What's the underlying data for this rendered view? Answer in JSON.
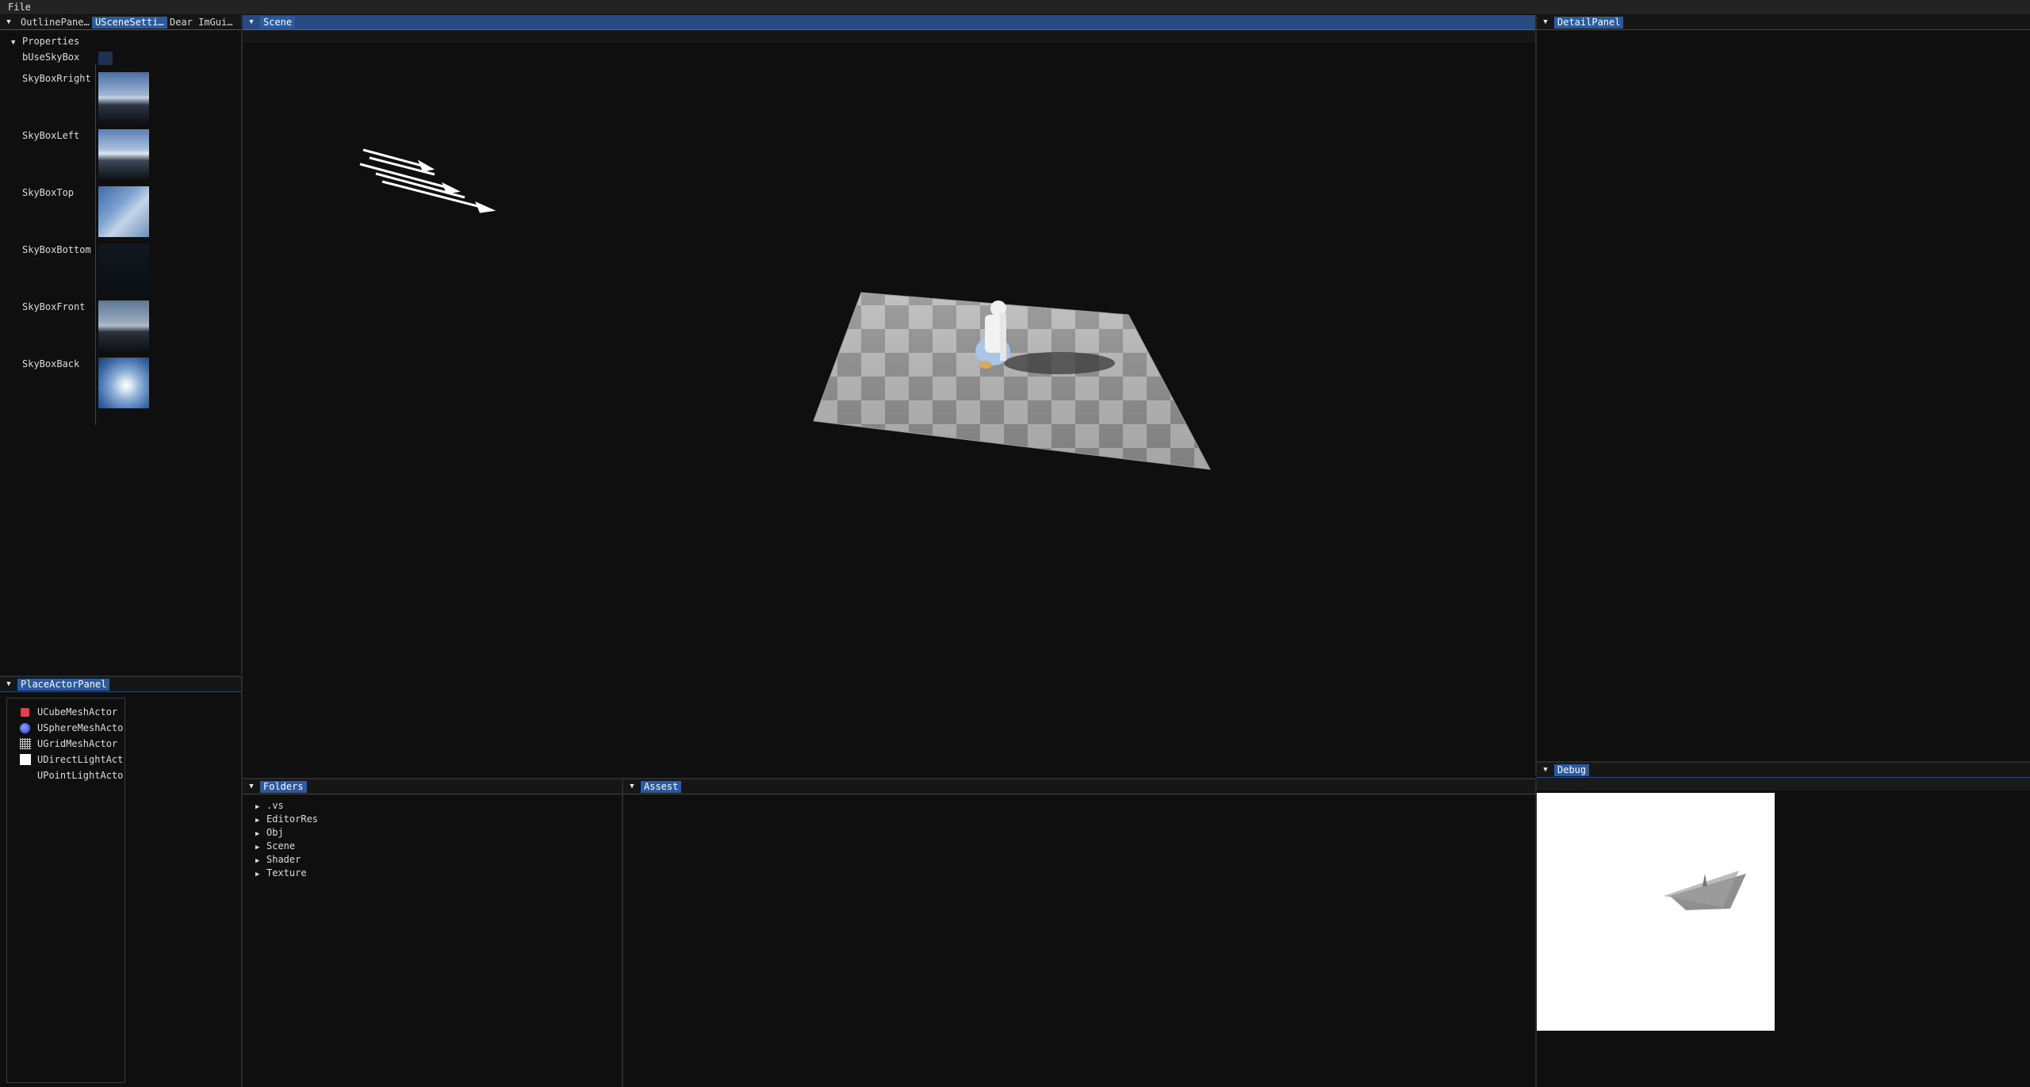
{
  "menubar": {
    "file_label": "File"
  },
  "left_panel": {
    "tabs": [
      {
        "label": "OutlinePane…"
      },
      {
        "label": "USceneSetti…"
      },
      {
        "label": "Dear ImGui…"
      }
    ],
    "properties_label": "Properties",
    "use_skybox_label": "bUseSkyBox",
    "skybox_items": [
      {
        "label": "SkyBoxRright"
      },
      {
        "label": "SkyBoxLeft"
      },
      {
        "label": "SkyBoxTop"
      },
      {
        "label": "SkyBoxBottom"
      },
      {
        "label": "SkyBoxFront"
      },
      {
        "label": "SkyBoxBack"
      }
    ]
  },
  "place_actor_panel": {
    "title": "PlaceActorPanel",
    "items": [
      {
        "label": "UCubeMeshActor",
        "icon": "cube-icon",
        "color": "#e04050"
      },
      {
        "label": "USphereMeshActo",
        "icon": "sphere-icon",
        "color": "#3a5ad8"
      },
      {
        "label": "UGridMeshActor",
        "icon": "grid-icon",
        "color": "#cccccc"
      },
      {
        "label": "UDirectLightAct",
        "icon": "light-icon",
        "color": "#ffffff"
      },
      {
        "label": "UPointLightActo",
        "icon": "point-light-icon",
        "color": "#0f0f0f"
      }
    ]
  },
  "scene_panel": {
    "title": "Scene"
  },
  "detail_panel": {
    "title": "DetailPanel"
  },
  "debug_panel": {
    "title": "Debug"
  },
  "folders_panel": {
    "title": "Folders",
    "items": [
      {
        "label": ".vs"
      },
      {
        "label": "EditorRes"
      },
      {
        "label": "Obj"
      },
      {
        "label": "Scene"
      },
      {
        "label": "Shader"
      },
      {
        "label": "Texture"
      }
    ]
  },
  "assets_panel": {
    "title": "Assest"
  },
  "colors": {
    "accent": "#2c5aa0",
    "background": "#0f0f0f"
  }
}
